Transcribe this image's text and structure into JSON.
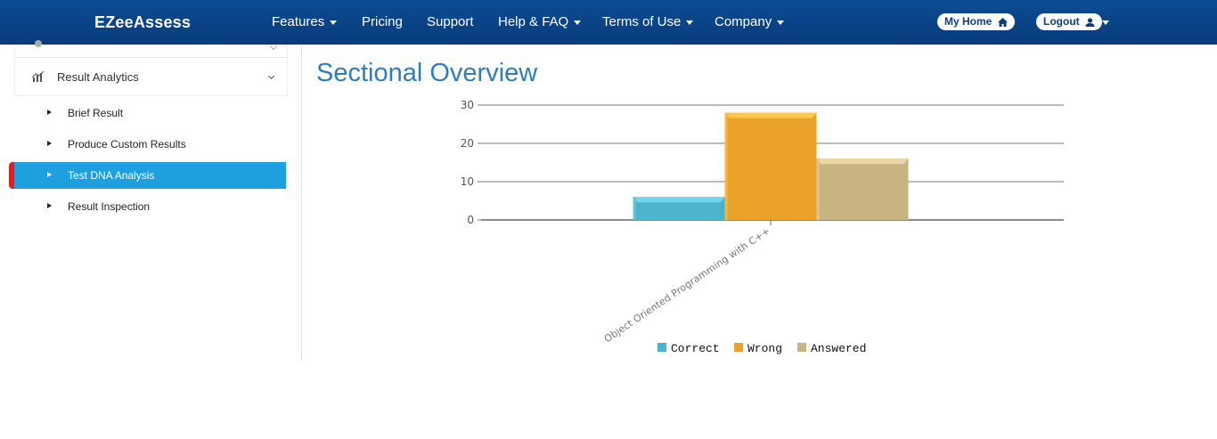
{
  "navbar": {
    "brand": "EZeeAssess",
    "items": [
      {
        "label": "Features",
        "has_caret": true
      },
      {
        "label": "Pricing",
        "has_caret": false
      },
      {
        "label": "Support",
        "has_caret": false
      },
      {
        "label": "Help & FAQ",
        "has_caret": true
      },
      {
        "label": "Terms of Use",
        "has_caret": true
      },
      {
        "label": "Company",
        "has_caret": true
      }
    ],
    "my_home": "My Home",
    "logout": "Logout"
  },
  "sidebar": {
    "section_label": "Result Analytics",
    "items": [
      {
        "label": "Brief Result",
        "active": false
      },
      {
        "label": "Produce Custom Results",
        "active": false
      },
      {
        "label": "Test DNA Analysis",
        "active": true
      },
      {
        "label": "Result Inspection",
        "active": false
      }
    ]
  },
  "main": {
    "title": "Sectional Overview"
  },
  "colors": {
    "navbar": "#0c4b93",
    "accent_title": "#2f7db8",
    "active_item": "#1d9fe0",
    "active_marker": "#e02020"
  },
  "chart_data": {
    "type": "bar",
    "categories": [
      "Object Oriented Programming with C++"
    ],
    "series": [
      {
        "name": "Correct",
        "values": [
          6
        ],
        "color": "#4bb4cc"
      },
      {
        "name": "Wrong",
        "values": [
          28
        ],
        "color": "#eaa22a"
      },
      {
        "name": "Answered",
        "values": [
          16
        ],
        "color": "#c7b482"
      }
    ],
    "ylim": [
      0,
      30
    ],
    "yticks": [
      0,
      10,
      20,
      30
    ],
    "grid": true,
    "legend": "bottom"
  }
}
